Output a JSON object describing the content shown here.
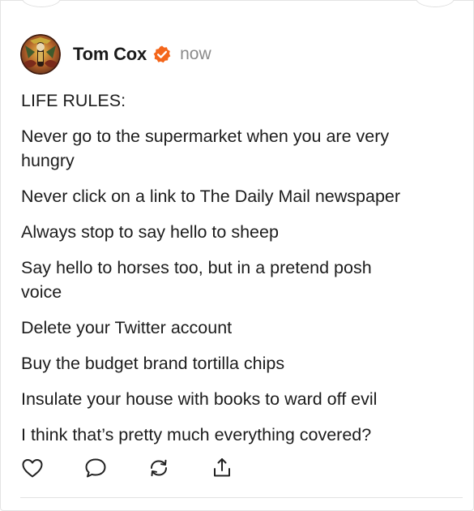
{
  "post": {
    "author": {
      "name": "Tom Cox",
      "avatar": "avatar-image",
      "verified_icon": "verified-check-icon",
      "verified_color": "#f4661b"
    },
    "timestamp": "now",
    "paragraphs": [
      "LIFE RULES:",
      "Never go to the supermarket when you are very hungry",
      "Never click on a link to The Daily Mail newspaper",
      "Always stop to say hello to sheep",
      "Say hello to horses too, but in a pretend posh voice",
      "Delete your Twitter account",
      "Buy the budget brand tortilla chips",
      "Insulate your house with books to ward off evil",
      "I think that’s pretty much everything covered?"
    ],
    "actions": [
      {
        "icon": "heart-icon"
      },
      {
        "icon": "comment-icon"
      },
      {
        "icon": "repost-icon"
      },
      {
        "icon": "share-icon"
      }
    ]
  },
  "colors": {
    "text": "#1c1c1c",
    "muted": "#8a8a8a",
    "divider": "#e2e2e2",
    "accent": "#f4661b"
  }
}
